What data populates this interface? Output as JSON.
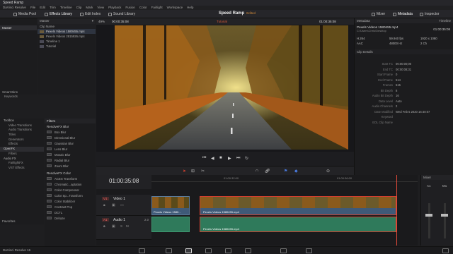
{
  "window_title": "Speed Ramp",
  "menu": [
    "DaVinci Resolve",
    "File",
    "Edit",
    "Trim",
    "Timeline",
    "Clip",
    "Mark",
    "View",
    "Playback",
    "Fusion",
    "Color",
    "Fairlight",
    "Workspace",
    "Help"
  ],
  "toolbar": {
    "media_pool": "Media Pool",
    "effects_library": "Effects Library",
    "edit_index": "Edit Index",
    "sound_library": "Sound Library",
    "mixer": "Mixer",
    "metadata": "Metadata",
    "inspector": "Inspector"
  },
  "project": {
    "name": "Speed Ramp",
    "status": "Edited"
  },
  "media_pool": {
    "master": "Master",
    "column": "Clip Name",
    "clips": [
      "Pexels Videos 1580455.mp4",
      "Pexels Videos 2815926.mp4",
      "Timeline 1",
      "Tutorial"
    ],
    "smart_bins": "Smart Bins",
    "keywords": "Keywords"
  },
  "viewer": {
    "zoom": "49%",
    "timecode_left": "00:00:35:08",
    "timeline_name": "Tutorial",
    "timecode_right": "01:00:35:08",
    "toolbar": "Timeline"
  },
  "fx_tree": {
    "items": [
      "Toolbox",
      "Video Transitions",
      "Audio Transitions",
      "Titles",
      "Generators",
      "Effects",
      "OpenFX",
      "Filters",
      "Audio FX",
      "FairlightFX",
      "VST Effects"
    ],
    "selected": "OpenFX",
    "favorites": "Favorites"
  },
  "fx_list": {
    "header": "Filters",
    "cat1": "ResolveFX Blur",
    "blur": [
      "Box Blur",
      "Directional Blur",
      "Gaussian Blur",
      "Lens Blur",
      "Mosaic Blur",
      "Radial Blur",
      "Zoom Blur"
    ],
    "cat2": "ResolveFX Color",
    "color": [
      "ACES Transform",
      "Chromatic...aptation",
      "Color Compressor",
      "Color Sp...Transform",
      "Color Stabilizer",
      "Contrast Pop",
      "DCTL",
      "Dehaze"
    ]
  },
  "metadata": {
    "header": "Metadata",
    "clip_name": "Pexels Videos 1580455.mp4",
    "clip_path": "C:\\Users\\Chris\\Desktop",
    "timecode": "01:00:35:08",
    "codec": "H.264",
    "fps": "59.940 fps",
    "resolution": "1920 x 1080",
    "audio": "AAC",
    "sample_rate": "48000 Hz",
    "channels": "2 Ch",
    "section": "Clip Details",
    "details": [
      {
        "k": "Start TC",
        "v": "00:00:00;00"
      },
      {
        "k": "End TC",
        "v": "00:00:08;31"
      },
      {
        "k": "Start Frame",
        "v": "0"
      },
      {
        "k": "End Frame",
        "v": "514"
      },
      {
        "k": "Frames",
        "v": "515"
      },
      {
        "k": "Bit Depth",
        "v": "8"
      },
      {
        "k": "Audio Bit Depth",
        "v": "16"
      },
      {
        "k": "Data Level",
        "v": "Auto"
      },
      {
        "k": "Audio Channels",
        "v": "2"
      },
      {
        "k": "Date Modified",
        "v": "Wed Feb 5 2020 16:40:07"
      },
      {
        "k": "Keyword",
        "v": ""
      },
      {
        "k": "EDL Clip Name",
        "v": ""
      }
    ]
  },
  "timeline": {
    "timecode": "01:00:35:08",
    "ruler": [
      "01:00:32:00",
      "01:00:36:00"
    ],
    "v1": "Video 1",
    "a1": "Audio 1",
    "a1_level": "2.0",
    "clip_a": "Pexels Videos 1580...",
    "clip_b": "Pexels Videos 1580455.mp4",
    "clip_c": "Pexels Videos 1580455.mp4"
  },
  "mixer": {
    "title": "Mixer",
    "a1": "A1",
    "m1": "M1"
  },
  "app_name": "DaVinci Resolve 16",
  "colors": {
    "accent": "#d0402f",
    "video_clip": "#3f5a78",
    "audio_clip": "#2f7a5b",
    "playhead": "#e04a3a"
  }
}
